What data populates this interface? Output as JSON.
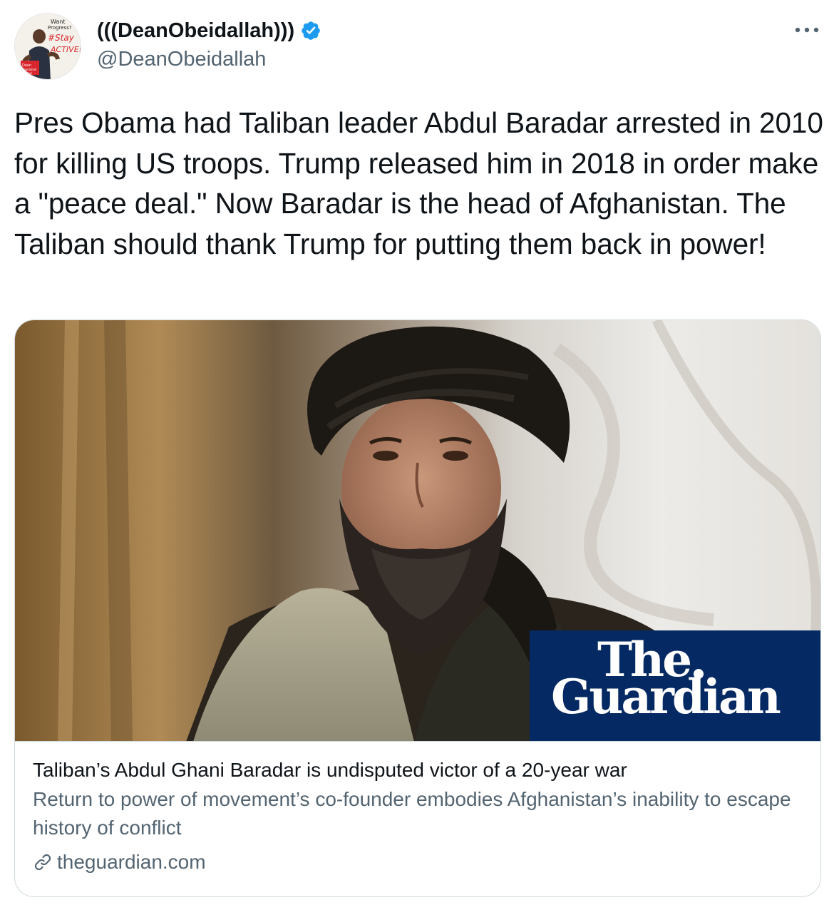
{
  "author": {
    "display_name": "(((DeanObeidallah)))",
    "handle": "@DeanObeidallah",
    "verified": true,
    "avatar_text": [
      "Want",
      "Progress?",
      "#Stay",
      "ACTIVE!",
      "Dean",
      "Obeidallah",
      "SHOW"
    ]
  },
  "more_icon": "more-horizontal-icon",
  "tweet": {
    "text": "Pres Obama had Taliban leader Abdul Baradar arrested in 2010 for killing US troops. Trump released him in 2018 in order make a \"peace deal.\" Now Baradar is the head of Afghanistan. The Taliban should thank Trump for putting them back in power!"
  },
  "card": {
    "image_alt": "Portrait of a man in a black turban",
    "logo_the": "The",
    "logo_name": "Guardian",
    "title": "Taliban’s Abdul Ghani Baradar is undisputed victor of a 20-year war",
    "description": "Return to power of movement’s co-founder embodies Afghanistan’s inability to escape history of conflict",
    "domain": "theguardian.com",
    "domain_icon": "link-icon"
  },
  "colors": {
    "verified_blue": "#1d9bf0",
    "text_primary": "#0f1419",
    "text_secondary": "#536471",
    "border": "#cfd9de",
    "guardian_blue": "#052962"
  }
}
